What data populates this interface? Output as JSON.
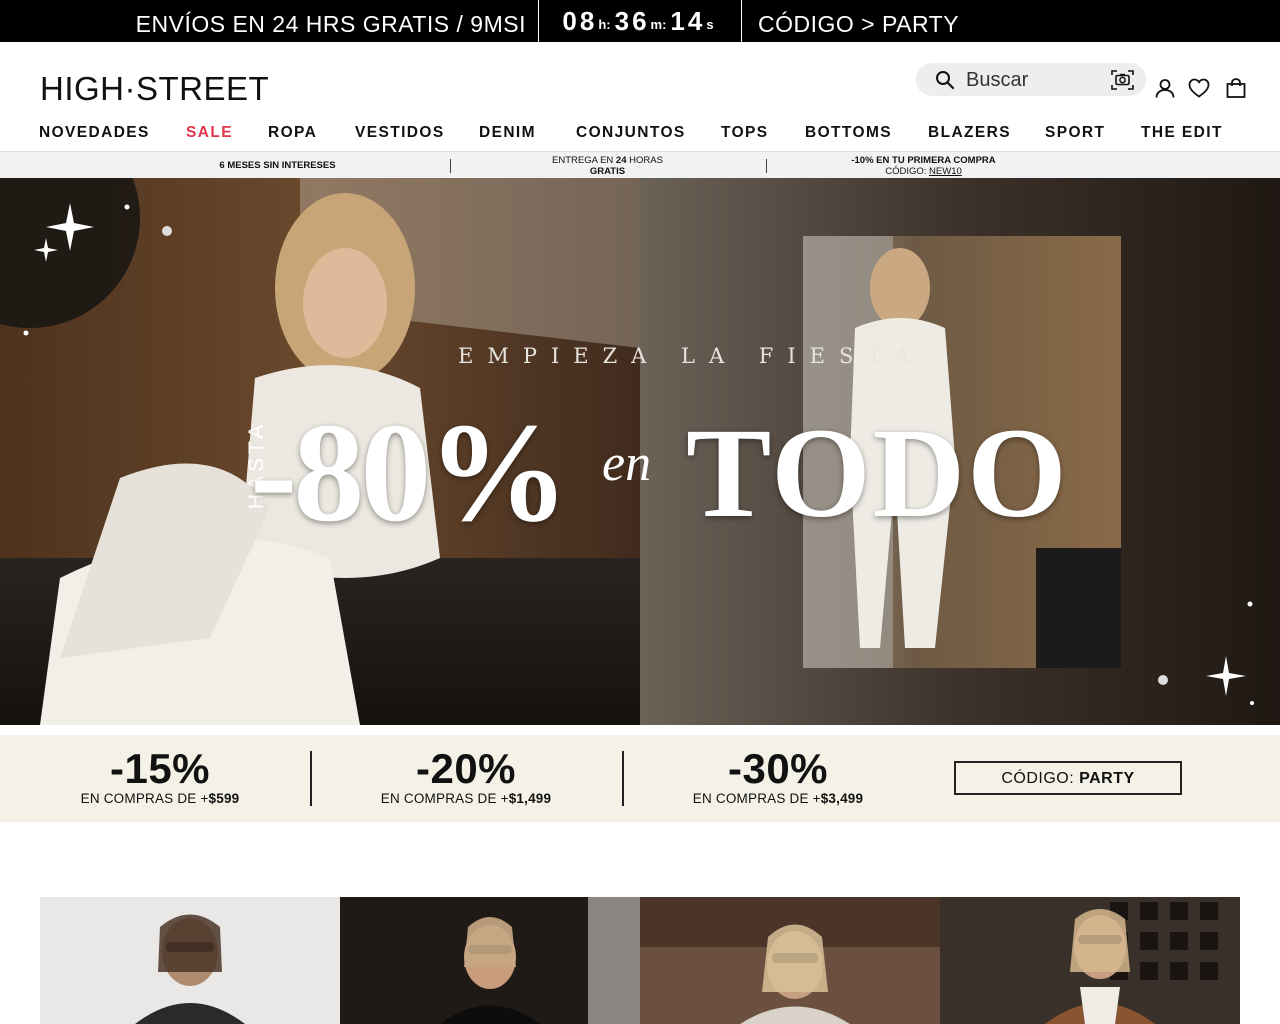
{
  "topbar": {
    "promo": "ENVÍOS EN 24 HRS GRATIS / 9MSI",
    "countdown": {
      "hours": "08",
      "hours_unit": "h:",
      "minutes": "36",
      "minutes_unit": "m:",
      "seconds": "14",
      "seconds_unit": "s"
    },
    "code_text": "CÓDIGO > PARTY"
  },
  "header": {
    "logo": "HIGH·STREET",
    "search_placeholder": "Buscar",
    "icons": [
      "search-icon",
      "camera-search-icon",
      "account-icon",
      "wishlist-heart-icon",
      "shopping-bag-icon"
    ]
  },
  "nav": {
    "items": [
      "NOVEDADES",
      "SALE",
      "ROPA",
      "VESTIDOS",
      "DENIM",
      "CONJUNTOS",
      "TOPS",
      "BOTTOMS",
      "BLAZERS",
      "SPORT",
      "THE EDIT"
    ],
    "sale_color": "#e0344a"
  },
  "perks": {
    "p1": "6 MESES SIN INTERESES",
    "p2_prefix": "ENTREGA EN ",
    "p2_bold": "24",
    "p2_suffix": " HORAS",
    "p2_line2": "GRATIS",
    "p3_line1": "-10% EN TU PRIMERA COMPRA",
    "p3_code_label": "CÓDIGO: ",
    "p3_code": "NEW10"
  },
  "hero": {
    "tagline": "EMPIEZA LA FIESTA",
    "hasta": "HASTA",
    "discount": "-80%",
    "en": "en",
    "todo": "TODO"
  },
  "discount_band": {
    "tiers": [
      {
        "pct": "-15%",
        "cond_prefix": "EN COMPRAS DE +",
        "cond_amount": "$599"
      },
      {
        "pct": "-20%",
        "cond_prefix": "EN COMPRAS DE +",
        "cond_amount": "$1,499"
      },
      {
        "pct": "-30%",
        "cond_prefix": "EN COMPRAS DE +",
        "cond_amount": "$3,499"
      }
    ],
    "code_label": "CÓDIGO: ",
    "code": "PARTY",
    "background": "#f4f1e6"
  },
  "tiles": [
    "product-tile-1",
    "product-tile-2",
    "product-tile-3",
    "product-tile-4"
  ]
}
